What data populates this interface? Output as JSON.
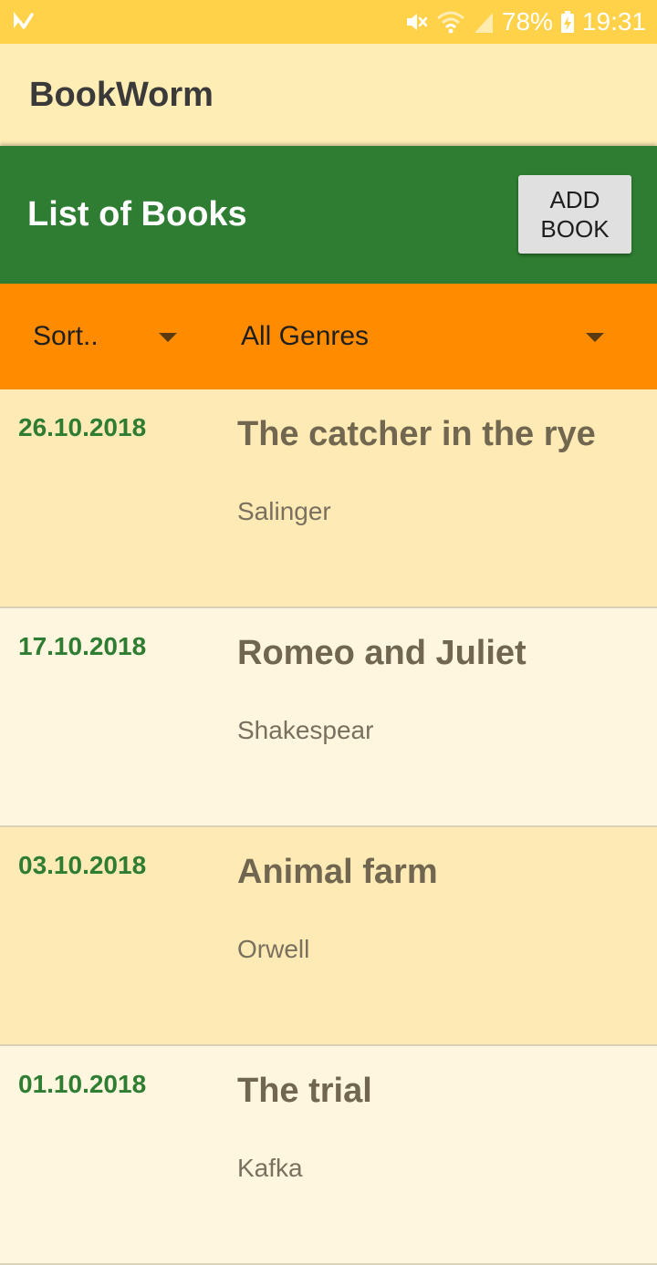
{
  "status_bar": {
    "battery": "78%",
    "time": "19:31"
  },
  "app_bar": {
    "title": "BookWorm"
  },
  "header": {
    "title": "List of Books",
    "add_button_label": "ADD BOOK"
  },
  "filters": {
    "sort_selected": "Sort..",
    "genre_selected": "All Genres"
  },
  "books": [
    {
      "date": "26.10.2018",
      "title": "The catcher in the rye",
      "author": "Salinger"
    },
    {
      "date": "17.10.2018",
      "title": "Romeo and Juliet",
      "author": "Shakespear"
    },
    {
      "date": "03.10.2018",
      "title": "Animal farm",
      "author": "Orwell"
    },
    {
      "date": "01.10.2018",
      "title": "The trial",
      "author": "Kafka"
    }
  ],
  "colors": {
    "status_bar": "#ffd24a",
    "app_bar": "#feedb4",
    "header": "#2e7d32",
    "filter_bar": "#ff8c00",
    "row_odd": "#feeab4",
    "row_even": "#fef6de",
    "date_text": "#2e7d32"
  },
  "icons": {
    "status_left": "notification-app-icon",
    "status_right": [
      "mute-icon",
      "wifi-icon",
      "signal-icon",
      "battery-charging-icon"
    ]
  }
}
